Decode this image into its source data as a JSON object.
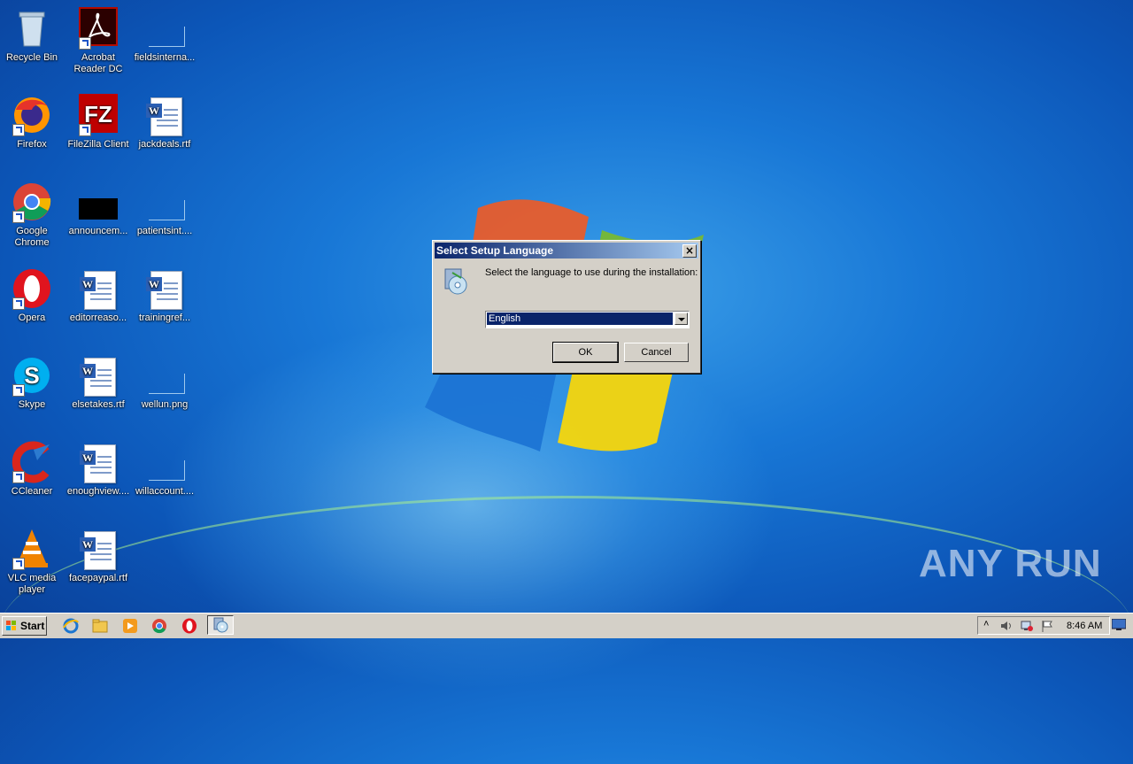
{
  "desktop": {
    "icons": [
      {
        "label": "Recycle Bin",
        "icon": "recycle-bin-icon"
      },
      {
        "label": "Acrobat Reader DC",
        "icon": "acrobat-icon"
      },
      {
        "label": "fieldsinterna...",
        "icon": "file-icon"
      },
      {
        "label": "Firefox",
        "icon": "firefox-icon"
      },
      {
        "label": "FileZilla Client",
        "icon": "filezilla-icon"
      },
      {
        "label": "jackdeals.rtf",
        "icon": "word-document-icon"
      },
      {
        "label": "Google Chrome",
        "icon": "chrome-icon"
      },
      {
        "label": "announcem...",
        "icon": "image-file-icon"
      },
      {
        "label": "patientsint....",
        "icon": "file-icon"
      },
      {
        "label": "Opera",
        "icon": "opera-icon"
      },
      {
        "label": "editorreaso...",
        "icon": "word-document-icon"
      },
      {
        "label": "trainingref...",
        "icon": "word-document-icon"
      },
      {
        "label": "Skype",
        "icon": "skype-icon"
      },
      {
        "label": "elsetakes.rtf",
        "icon": "word-document-icon"
      },
      {
        "label": "wellun.png",
        "icon": "file-icon"
      },
      {
        "label": "CCleaner",
        "icon": "ccleaner-icon"
      },
      {
        "label": "enoughview....",
        "icon": "word-document-icon"
      },
      {
        "label": "willaccount....",
        "icon": "file-icon"
      },
      {
        "label": "VLC media player",
        "icon": "vlc-icon"
      },
      {
        "label": "facepaypal.rtf",
        "icon": "word-document-icon"
      }
    ]
  },
  "dialog": {
    "title": "Select Setup Language",
    "prompt": "Select the language to use during the installation:",
    "selected_language": "English",
    "ok_label": "OK",
    "cancel_label": "Cancel"
  },
  "taskbar": {
    "start_label": "Start",
    "clock": "8:46 AM",
    "pinned": [
      "internet-explorer-icon",
      "explorer-folder-icon",
      "media-player-icon",
      "chrome-icon",
      "opera-icon",
      "setup-icon"
    ]
  },
  "watermark": "ANY RUN",
  "colors": {
    "titlebar_start": "#0a246a",
    "titlebar_end": "#a6caf0",
    "dialog_bg": "#d4d0c8",
    "desktop_blue": "#1877d6"
  }
}
